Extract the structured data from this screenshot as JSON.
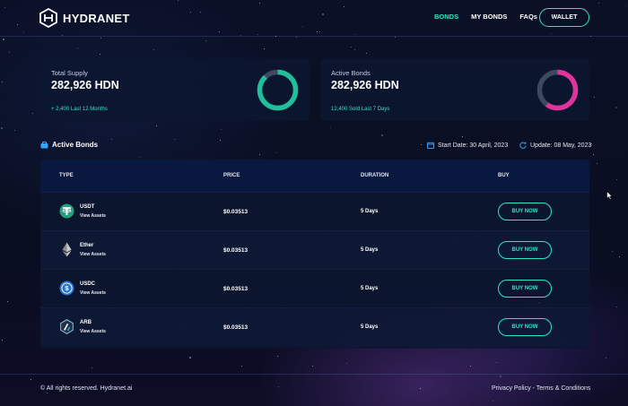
{
  "brand": {
    "name": "HYDRANET"
  },
  "nav": {
    "items": [
      {
        "label": "BONDS",
        "active": true
      },
      {
        "label": "MY BONDS",
        "active": false
      },
      {
        "label": "FAQs",
        "active": false
      }
    ],
    "wallet_label": "WALLET"
  },
  "stats": {
    "total_supply": {
      "label": "Total Supply",
      "value": "282,926 HDN",
      "sub": "+ 2,400 Last 12 Months",
      "ring_fraction": 0.88,
      "ring_color": "#1fbf9b"
    },
    "active_bonds": {
      "label": "Active Bonds",
      "value": "282,926 HDN",
      "sub": "12,400 Sold Last 7 Days",
      "ring_fraction": 0.6,
      "ring_color": "#e0339c"
    }
  },
  "section": {
    "title": "Active Bonds",
    "start_date": "Start Date: 30 April, 2023",
    "update": "Update: 08 May, 2023"
  },
  "table": {
    "headers": {
      "type": "TYPE",
      "price": "PRICE",
      "duration": "DURATION",
      "buy": "BUY"
    },
    "rows": [
      {
        "name": "USDT",
        "icon": "tether-icon",
        "view": "View Assets",
        "price": "$0.03513",
        "duration": "5 Days",
        "buy": "BUY NOW"
      },
      {
        "name": "Ether",
        "icon": "ethereum-icon",
        "view": "View Assets",
        "price": "$0.03513",
        "duration": "5 Days",
        "buy": "BUY NOW"
      },
      {
        "name": "USDC",
        "icon": "usdc-icon",
        "view": "View Assets",
        "price": "$0.03513",
        "duration": "5 Days",
        "buy": "BUY NOW"
      },
      {
        "name": "ARB",
        "icon": "arbitrum-icon",
        "view": "View Assets",
        "price": "$0.03513",
        "duration": "5 Days",
        "buy": "BUY NOW"
      }
    ]
  },
  "footer": {
    "copyright": "© All rights reserved. Hydranet.ai",
    "privacy": "Privacy Policy",
    "separator": "-",
    "terms": "Terms & Conditions"
  },
  "colors": {
    "accent": "#2ee6c4",
    "pink": "#e0339c",
    "teal": "#1fbf9b"
  }
}
